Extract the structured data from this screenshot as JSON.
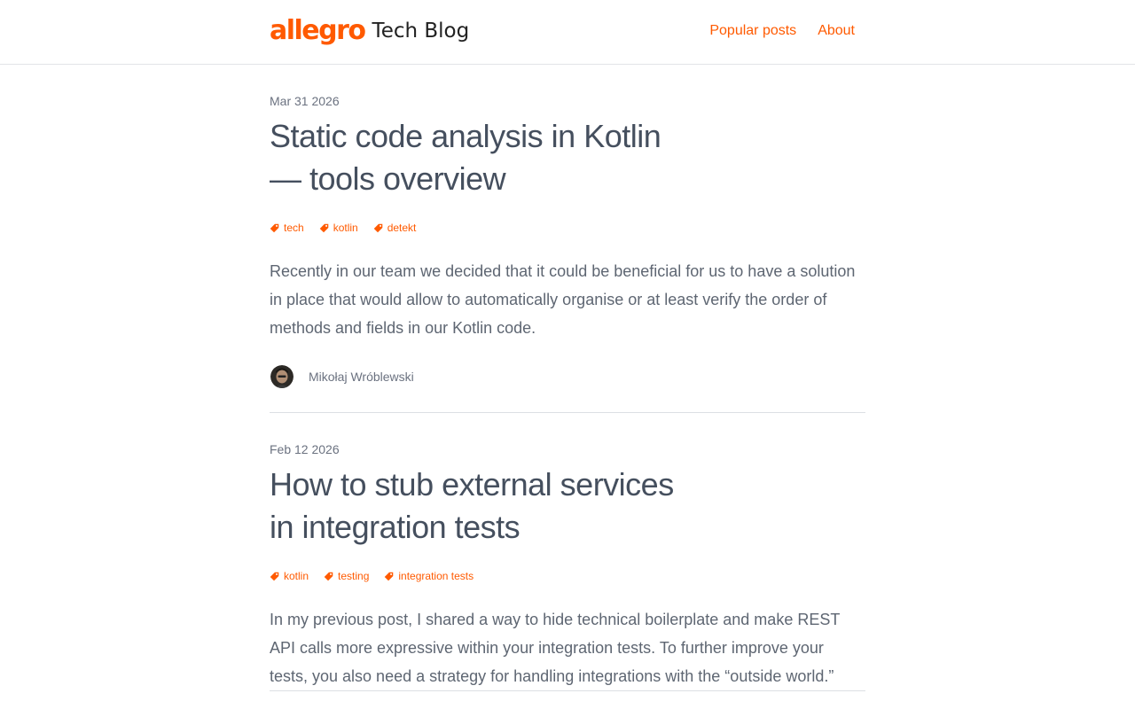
{
  "header": {
    "logo_brand": "allegro",
    "logo_sub": "Tech Blog",
    "nav": [
      {
        "label": "Popular posts"
      },
      {
        "label": "About"
      }
    ]
  },
  "posts": [
    {
      "date": "Mar 31 2026",
      "title": "Static code analysis in Kotlin — tools overview",
      "tags": [
        "tech",
        "kotlin",
        "detekt"
      ],
      "excerpt": "Recently in our team we decided that it could be beneficial for us to have a solution in place that would allow to automatically organise or at least verify the order of methods and fields in our Kotlin code.",
      "author": "Mikołaj Wróblewski"
    },
    {
      "date": "Feb 12 2026",
      "title": "How to stub external services in integration tests",
      "tags": [
        "kotlin",
        "testing",
        "integration tests"
      ],
      "excerpt": "In my previous post, I shared a way to hide technical boilerplate and make REST API calls more expressive within your integration tests. To further improve your tests, you also need a strategy for handling integrations with the “outside world.”"
    }
  ],
  "colors": {
    "accent": "#ff5a00",
    "title": "#454f5e",
    "text": "#5e6672",
    "muted": "#6b7280"
  },
  "icons": {
    "tag": "tag-icon",
    "avatar": "author-avatar"
  }
}
